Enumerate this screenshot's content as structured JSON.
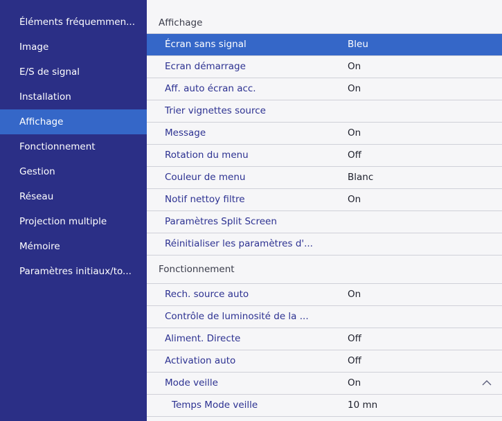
{
  "sidebar": {
    "items": [
      {
        "label": "Éléments fréquemmen..."
      },
      {
        "label": "Image"
      },
      {
        "label": "E/S de signal"
      },
      {
        "label": "Installation"
      },
      {
        "label": "Affichage"
      },
      {
        "label": "Fonctionnement"
      },
      {
        "label": "Gestion"
      },
      {
        "label": "Réseau"
      },
      {
        "label": "Projection multiple"
      },
      {
        "label": "Mémoire"
      },
      {
        "label": "Paramètres initiaux/to..."
      }
    ],
    "active_index": 4
  },
  "panel": {
    "section1": {
      "title": "Affichage",
      "rows": [
        {
          "label": "Écran sans signal",
          "value": "Bleu"
        },
        {
          "label": "Ecran démarrage",
          "value": "On"
        },
        {
          "label": "Aff. auto écran acc.",
          "value": "On"
        },
        {
          "label": "Trier vignettes source",
          "value": ""
        },
        {
          "label": "Message",
          "value": "On"
        },
        {
          "label": "Rotation du menu",
          "value": "Off"
        },
        {
          "label": "Couleur de menu",
          "value": "Blanc"
        },
        {
          "label": "Notif nettoy filtre",
          "value": "On"
        },
        {
          "label": "Paramètres Split Screen",
          "value": ""
        },
        {
          "label": "Réinitialiser les paramètres d'...",
          "value": ""
        }
      ]
    },
    "section2": {
      "title": "Fonctionnement",
      "rows": [
        {
          "label": "Rech. source auto",
          "value": "On"
        },
        {
          "label": "Contrôle de luminosité de la ...",
          "value": ""
        },
        {
          "label": "Aliment. Directe",
          "value": "Off"
        },
        {
          "label": "Activation auto",
          "value": "Off"
        },
        {
          "label": "Mode veille",
          "value": "On"
        },
        {
          "label": "Temps Mode veille",
          "value": "10 mn"
        }
      ]
    }
  },
  "colors": {
    "sidebar_bg": "#2b2f86",
    "highlight": "#3567c8",
    "panel_bg": "#f6f6f8",
    "row_text": "#2c3191"
  },
  "icons": {
    "collapse": "chevron-up-icon"
  }
}
